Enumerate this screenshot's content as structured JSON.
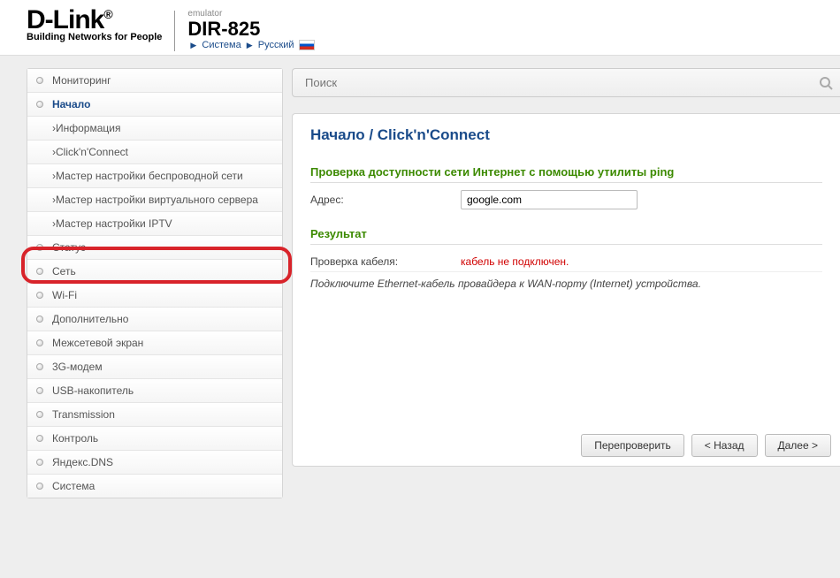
{
  "header": {
    "logo_text": "D-Link",
    "logo_tagline": "Building Networks for People",
    "emulator": "emulator",
    "model": "DIR-825",
    "crumb_system": "Система",
    "crumb_lang": "Русский"
  },
  "search": {
    "placeholder": "Поиск"
  },
  "sidebar": {
    "items": [
      {
        "label": "Мониторинг"
      },
      {
        "label": "Начало",
        "active": true,
        "sub": [
          {
            "label": "Информация"
          },
          {
            "label": "Click'n'Connect",
            "highlighted": true
          },
          {
            "label": "Мастер настройки беспроводной сети"
          },
          {
            "label": "Мастер настройки виртуального сервера"
          },
          {
            "label": "Мастер настройки IPTV"
          }
        ]
      },
      {
        "label": "Статус"
      },
      {
        "label": "Сеть"
      },
      {
        "label": "Wi-Fi"
      },
      {
        "label": "Дополнительно"
      },
      {
        "label": "Межсетевой экран"
      },
      {
        "label": "3G-модем"
      },
      {
        "label": "USB-накопитель"
      },
      {
        "label": "Transmission"
      },
      {
        "label": "Контроль"
      },
      {
        "label": "Яндекс.DNS"
      },
      {
        "label": "Система"
      }
    ]
  },
  "page": {
    "breadcrumb": "Начало /  Click'n'Connect",
    "ping_section": "Проверка доступности сети Интернет с помощью утилиты ping",
    "address_label": "Адрес:",
    "address_value": "google.com",
    "result_section": "Результат",
    "cable_check_label": "Проверка кабеля:",
    "cable_check_value": "кабель не подключен.",
    "note": "Подключите Ethernet-кабель провайдера к WAN-порту (Internet) устройства.",
    "btn_recheck": "Перепроверить",
    "btn_back": "< Назад",
    "btn_next": "Далее >"
  }
}
